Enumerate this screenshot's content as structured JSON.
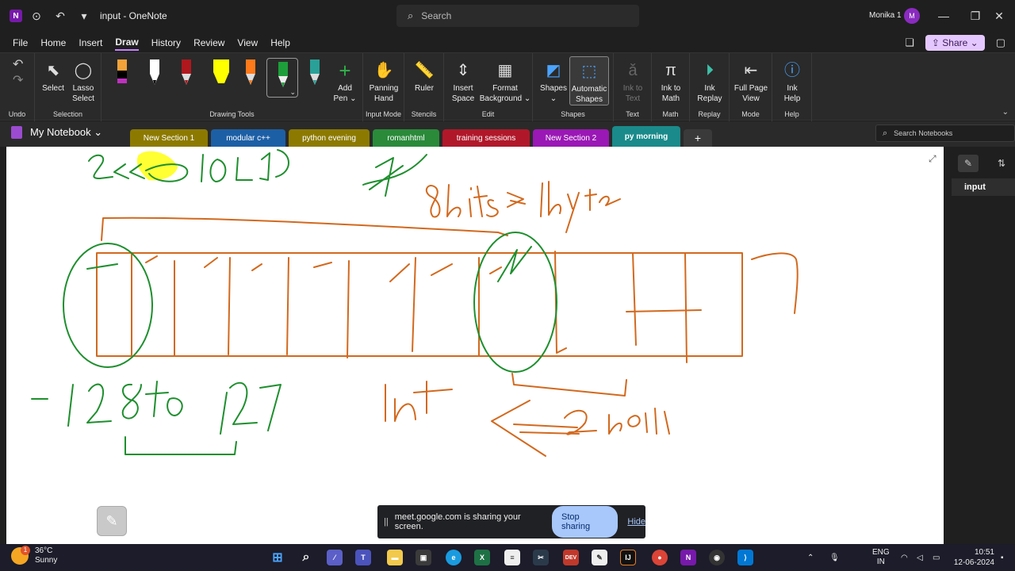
{
  "titlebar": {
    "title": "input  -  OneNote",
    "app_icon": "N",
    "search_placeholder": "Search",
    "user_name": "Monika 1",
    "avatar_initial": "M"
  },
  "menu": {
    "items": [
      "File",
      "Home",
      "Insert",
      "Draw",
      "History",
      "Review",
      "View",
      "Help"
    ],
    "active": "Draw",
    "share_label": "Share"
  },
  "ribbon": {
    "groups": {
      "undo": "Undo",
      "selection": "Selection",
      "drawing_tools": "Drawing Tools",
      "input_mode": "Input Mode",
      "stencils": "Stencils",
      "edit": "Edit",
      "shapes": "Shapes",
      "text": "Text",
      "math": "Math",
      "replay": "Replay",
      "mode": "Mode",
      "help": "Help"
    },
    "buttons": {
      "select": "Select",
      "lasso_1": "Lasso",
      "lasso_2": "Select",
      "add_pen_1": "Add",
      "add_pen_2": "Pen ⌄",
      "panning_1": "Panning",
      "panning_2": "Hand",
      "ruler": "Ruler",
      "insert_space_1": "Insert",
      "insert_space_2": "Space",
      "format_bg_1": "Format",
      "format_bg_2": "Background ⌄",
      "shapes": "Shapes",
      "auto_shapes_1": "Automatic",
      "auto_shapes_2": "Shapes",
      "ink_text_1": "Ink to",
      "ink_text_2": "Text",
      "ink_math_1": "Ink to",
      "ink_math_2": "Math",
      "ink_replay_1": "Ink",
      "ink_replay_2": "Replay",
      "full_page_1": "Full Page",
      "full_page_2": "View",
      "ink_help_1": "Ink",
      "ink_help_2": "Help"
    },
    "pen_colors": [
      "#f2a33a",
      "#ffffff",
      "#b0181e",
      "#ffff00",
      "#ff7a1a",
      "#1e9e3a",
      "#2aa198"
    ]
  },
  "notebook": {
    "name": "My Notebook ⌄",
    "sections": [
      {
        "label": "New Section 1",
        "color": "#8c7a00"
      },
      {
        "label": "modular c++",
        "color": "#1d5fa5"
      },
      {
        "label": "python evening",
        "color": "#8c7a00"
      },
      {
        "label": "romanhtml",
        "color": "#2a8a3a"
      },
      {
        "label": "training sessions",
        "color": "#b0182a"
      },
      {
        "label": "New Section 2",
        "color": "#9a18b5"
      },
      {
        "label": "py morning",
        "color": "#1a8a8a"
      }
    ],
    "add_section": "+",
    "search_placeholder": "Search Notebooks"
  },
  "pages": {
    "items": [
      "input"
    ]
  },
  "sharing": {
    "pause": "||",
    "message": "meet.google.com is sharing your screen.",
    "stop_label": "Stop sharing",
    "hide_label": "Hide"
  },
  "taskbar": {
    "weather_temp": "36°C",
    "weather_desc": "Sunny",
    "weather_badge": "1",
    "lang_1": "ENG",
    "lang_2": "IN",
    "time": "10:51",
    "date": "12-06-2024"
  },
  "colors": {
    "accent": "#c880ff",
    "ink_orange": "#d2691e",
    "ink_green": "#1e8f2e"
  }
}
